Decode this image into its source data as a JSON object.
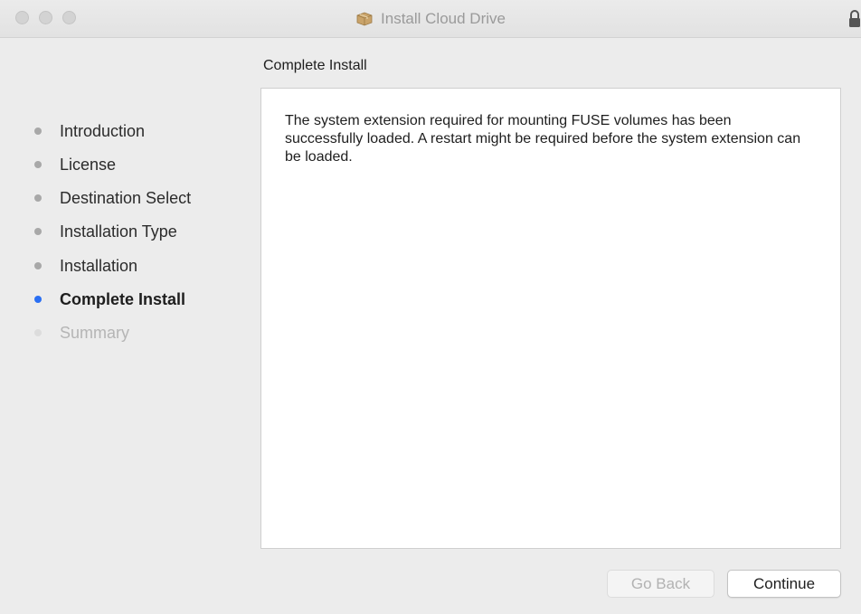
{
  "window": {
    "title": "Install Cloud Drive",
    "app_icon": "installer-box-icon",
    "lock_icon": "lock-icon"
  },
  "sidebar": {
    "steps": [
      {
        "label": "Introduction",
        "state": "done"
      },
      {
        "label": "License",
        "state": "done"
      },
      {
        "label": "Destination Select",
        "state": "done"
      },
      {
        "label": "Installation Type",
        "state": "done"
      },
      {
        "label": "Installation",
        "state": "done"
      },
      {
        "label": "Complete Install",
        "state": "current"
      },
      {
        "label": "Summary",
        "state": "future"
      }
    ]
  },
  "main": {
    "title": "Complete Install",
    "message": "The system extension required for mounting FUSE volumes has been successfully loaded. A restart might be required before the system extension can be loaded."
  },
  "footer": {
    "back_label": "Go Back",
    "continue_label": "Continue"
  },
  "colors": {
    "current_step_dot": "#2a6ff3",
    "done_step_dot": "#a8a8a8",
    "future_step_text": "#b5b5b5"
  }
}
